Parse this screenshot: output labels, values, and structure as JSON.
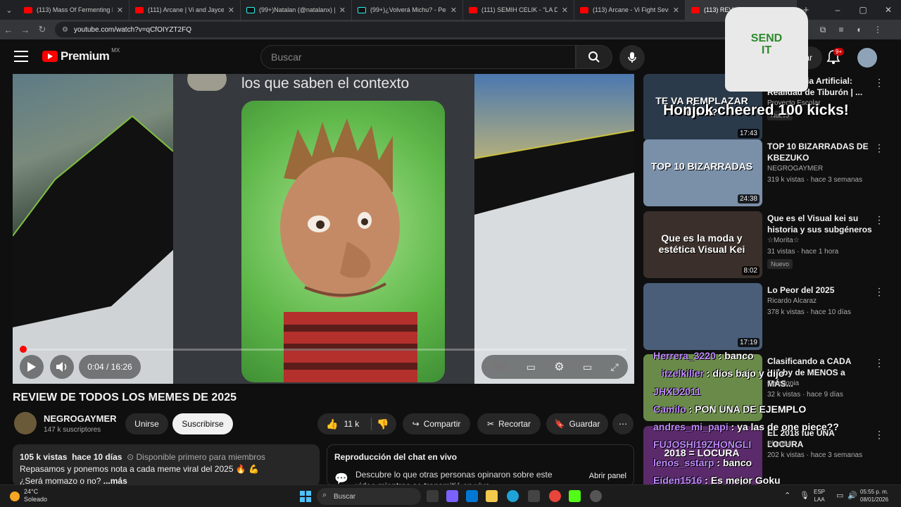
{
  "browser": {
    "tabs": [
      {
        "label": "(113) Mass Of Fermenting Dreg",
        "kind": "yt"
      },
      {
        "label": "(111) Arcane | Vi and Jayce Figh",
        "kind": "yt"
      },
      {
        "label": "(99+)Natalan (@natalanx) | Tik",
        "kind": "tt"
      },
      {
        "label": "(99+)¿Volverá Michu? - Perspe",
        "kind": "tt"
      },
      {
        "label": "(111) SEMIH CELIK - \"LA DOBLE",
        "kind": "yt"
      },
      {
        "label": "(113) Arcane - Vi Fight Sevika S",
        "kind": "yt"
      },
      {
        "label": "(113) REVIEW DE TODOS",
        "kind": "yt",
        "active": true
      }
    ],
    "url": "youtube.com/watch?v=qCfOIYZT2FQ"
  },
  "header": {
    "logo_text": "Premium",
    "country": "MX",
    "search_placeholder": "Buscar",
    "create_label": "Crear",
    "notif_count": "9+"
  },
  "player": {
    "caption": "los que saben el contexto",
    "time": "0:04 / 16:26",
    "progress": 0.004
  },
  "video": {
    "title": "REVIEW DE TODOS LOS MEMES DE 2025",
    "channel": "NEGROGAYMER",
    "subs": "147 k suscriptores",
    "join": "Unirse",
    "subscribe": "Suscribirse",
    "likes": "11 k",
    "share": "Compartir",
    "clip": "Recortar",
    "save": "Guardar"
  },
  "description": {
    "views": "105 k vistas",
    "date": "hace 10 días",
    "members": "Disponible primero para miembros",
    "line1": "Repasamos y ponemos nota a cada meme viral del 2025 🔥 💪",
    "line2": "¿Será momazo o no?",
    "more": "...más"
  },
  "live_chat": {
    "title": "Reproducción del chat en vivo",
    "desc": "Descubre lo que otras personas opinaron sobre este video mientras se transmitió en vivo.",
    "open": "Abrir panel"
  },
  "recommendations": [
    {
      "title": "Inteligencia Artificial: Realidad de Tiburón | ...",
      "channel": "Proyecto Escolar",
      "meta": "",
      "duration": "17:43",
      "new": "Nuevo",
      "thumb_caption": "TE VA REMPLAZAR LA IA?",
      "thumb_color": "#2b3a4a"
    },
    {
      "title": "TOP 10 BIZARRADAS DE KBEZUKO",
      "channel": "NEGROGAYMER",
      "meta": "319 k vistas · hace 3 semanas",
      "duration": "24:38",
      "new": "",
      "thumb_caption": "TOP 10 BIZARRADAS",
      "thumb_color": "#7a8fa8"
    },
    {
      "title": "Que es el Visual kei su historia y sus subgéneros",
      "channel": "☆Morita☆",
      "meta": "31 vistas · hace 1 hora",
      "duration": "8:02",
      "new": "Nuevo",
      "thumb_caption": "Que es la moda y estética Visual Kei",
      "thumb_color": "#3a2f2a"
    },
    {
      "title": "Lo Peor del 2025",
      "channel": "Ricardo Alcaraz",
      "meta": "378 k vistas · hace 10 días",
      "duration": "17:19",
      "new": "",
      "thumb_caption": "",
      "thumb_color": "#4a5e7a"
    },
    {
      "title": "Clasificando a CADA Lobby de MENOS a MÁS...",
      "channel": "Caledonia",
      "meta": "32 k vistas · hace 9 días",
      "duration": "",
      "new": "",
      "thumb_caption": "",
      "thumb_color": "#6a8a4a"
    },
    {
      "title": "EL 2018 fue UNA LOCURA",
      "channel": "Plum64",
      "meta": "202 k vistas · hace 3 semanas",
      "duration": "",
      "new": "",
      "thumb_caption": "2018 = LOCURA",
      "thumb_color": "#5a2a6a"
    }
  ],
  "overlay": {
    "cheer": "Honjok cheered 100 kicks!",
    "shirt_text": "SEND IT",
    "chat": [
      {
        "user": "Herrera_3220",
        "msg": "banco"
      },
      {
        "user": "itzelkiller",
        "msg": "dios bajo y dijo"
      },
      {
        "user": "JHXD2011",
        "msg": ""
      },
      {
        "user": "Camilo",
        "msg": "PON UNA DE EJEMPLO"
      },
      {
        "user": "andres_mi_papi",
        "msg": "ya las de one piece??"
      },
      {
        "user": "FUJOSHI19ZHONGLI",
        "msg": ""
      },
      {
        "user": "lenos_sstarp",
        "msg": "banco"
      },
      {
        "user": "Eiden1516",
        "msg": "Es mejor Goku"
      }
    ]
  },
  "taskbar": {
    "temp": "24°C",
    "weather": "Soleado",
    "search": "Buscar",
    "lang": "ESP",
    "region": "LAA",
    "time": "05:55 p. m.",
    "date": "08/01/2026"
  }
}
